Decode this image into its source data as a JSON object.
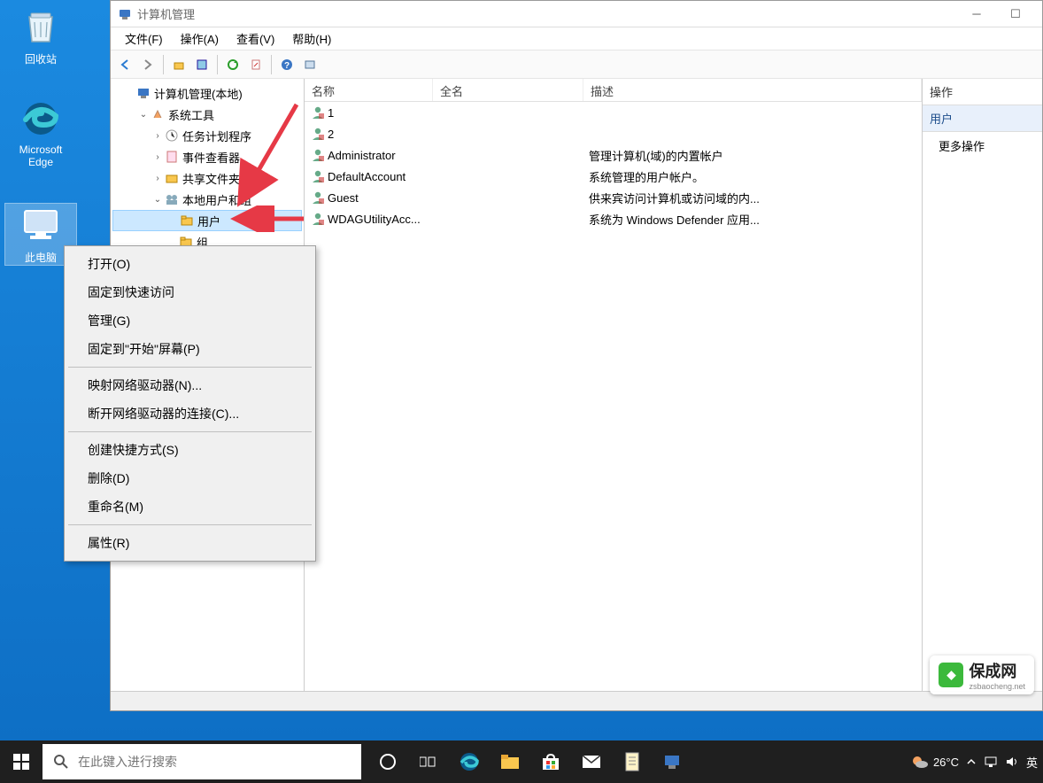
{
  "desktop": {
    "recycle_bin": "回收站",
    "edge": "Microsoft Edge",
    "this_pc": "此电脑"
  },
  "window": {
    "title": "计算机管理",
    "menus": {
      "file": "文件(F)",
      "action": "操作(A)",
      "view": "查看(V)",
      "help": "帮助(H)"
    }
  },
  "tree": {
    "root": "计算机管理(本地)",
    "system_tools": "系统工具",
    "task_scheduler": "任务计划程序",
    "event_viewer": "事件查看器",
    "shared_folders": "共享文件夹",
    "local_users": "本地用户和组",
    "users": "用户",
    "groups": "组"
  },
  "list": {
    "headers": {
      "name": "名称",
      "fullname": "全名",
      "desc": "描述"
    },
    "rows": [
      {
        "name": "1",
        "full": "",
        "desc": ""
      },
      {
        "name": "2",
        "full": "",
        "desc": ""
      },
      {
        "name": "Administrator",
        "full": "",
        "desc": "管理计算机(域)的内置帐户"
      },
      {
        "name": "DefaultAccount",
        "full": "",
        "desc": "系统管理的用户帐户。"
      },
      {
        "name": "Guest",
        "full": "",
        "desc": "供来宾访问计算机或访问域的内..."
      },
      {
        "name": "WDAGUtilityAcc...",
        "full": "",
        "desc": "系统为 Windows Defender 应用..."
      }
    ]
  },
  "actions": {
    "title": "操作",
    "section": "用户",
    "more": "更多操作"
  },
  "context": {
    "open": "打开(O)",
    "pin_quick": "固定到快速访问",
    "manage": "管理(G)",
    "pin_start": "固定到\"开始\"屏幕(P)",
    "map_drive": "映射网络驱动器(N)...",
    "disconnect": "断开网络驱动器的连接(C)...",
    "shortcut": "创建快捷方式(S)",
    "delete": "删除(D)",
    "rename": "重命名(M)",
    "properties": "属性(R)"
  },
  "taskbar": {
    "search_placeholder": "在此键入进行搜索",
    "weather": "26°C",
    "ime": "英"
  },
  "watermark": {
    "title": "保成网",
    "sub": "zsbaocheng.net"
  }
}
